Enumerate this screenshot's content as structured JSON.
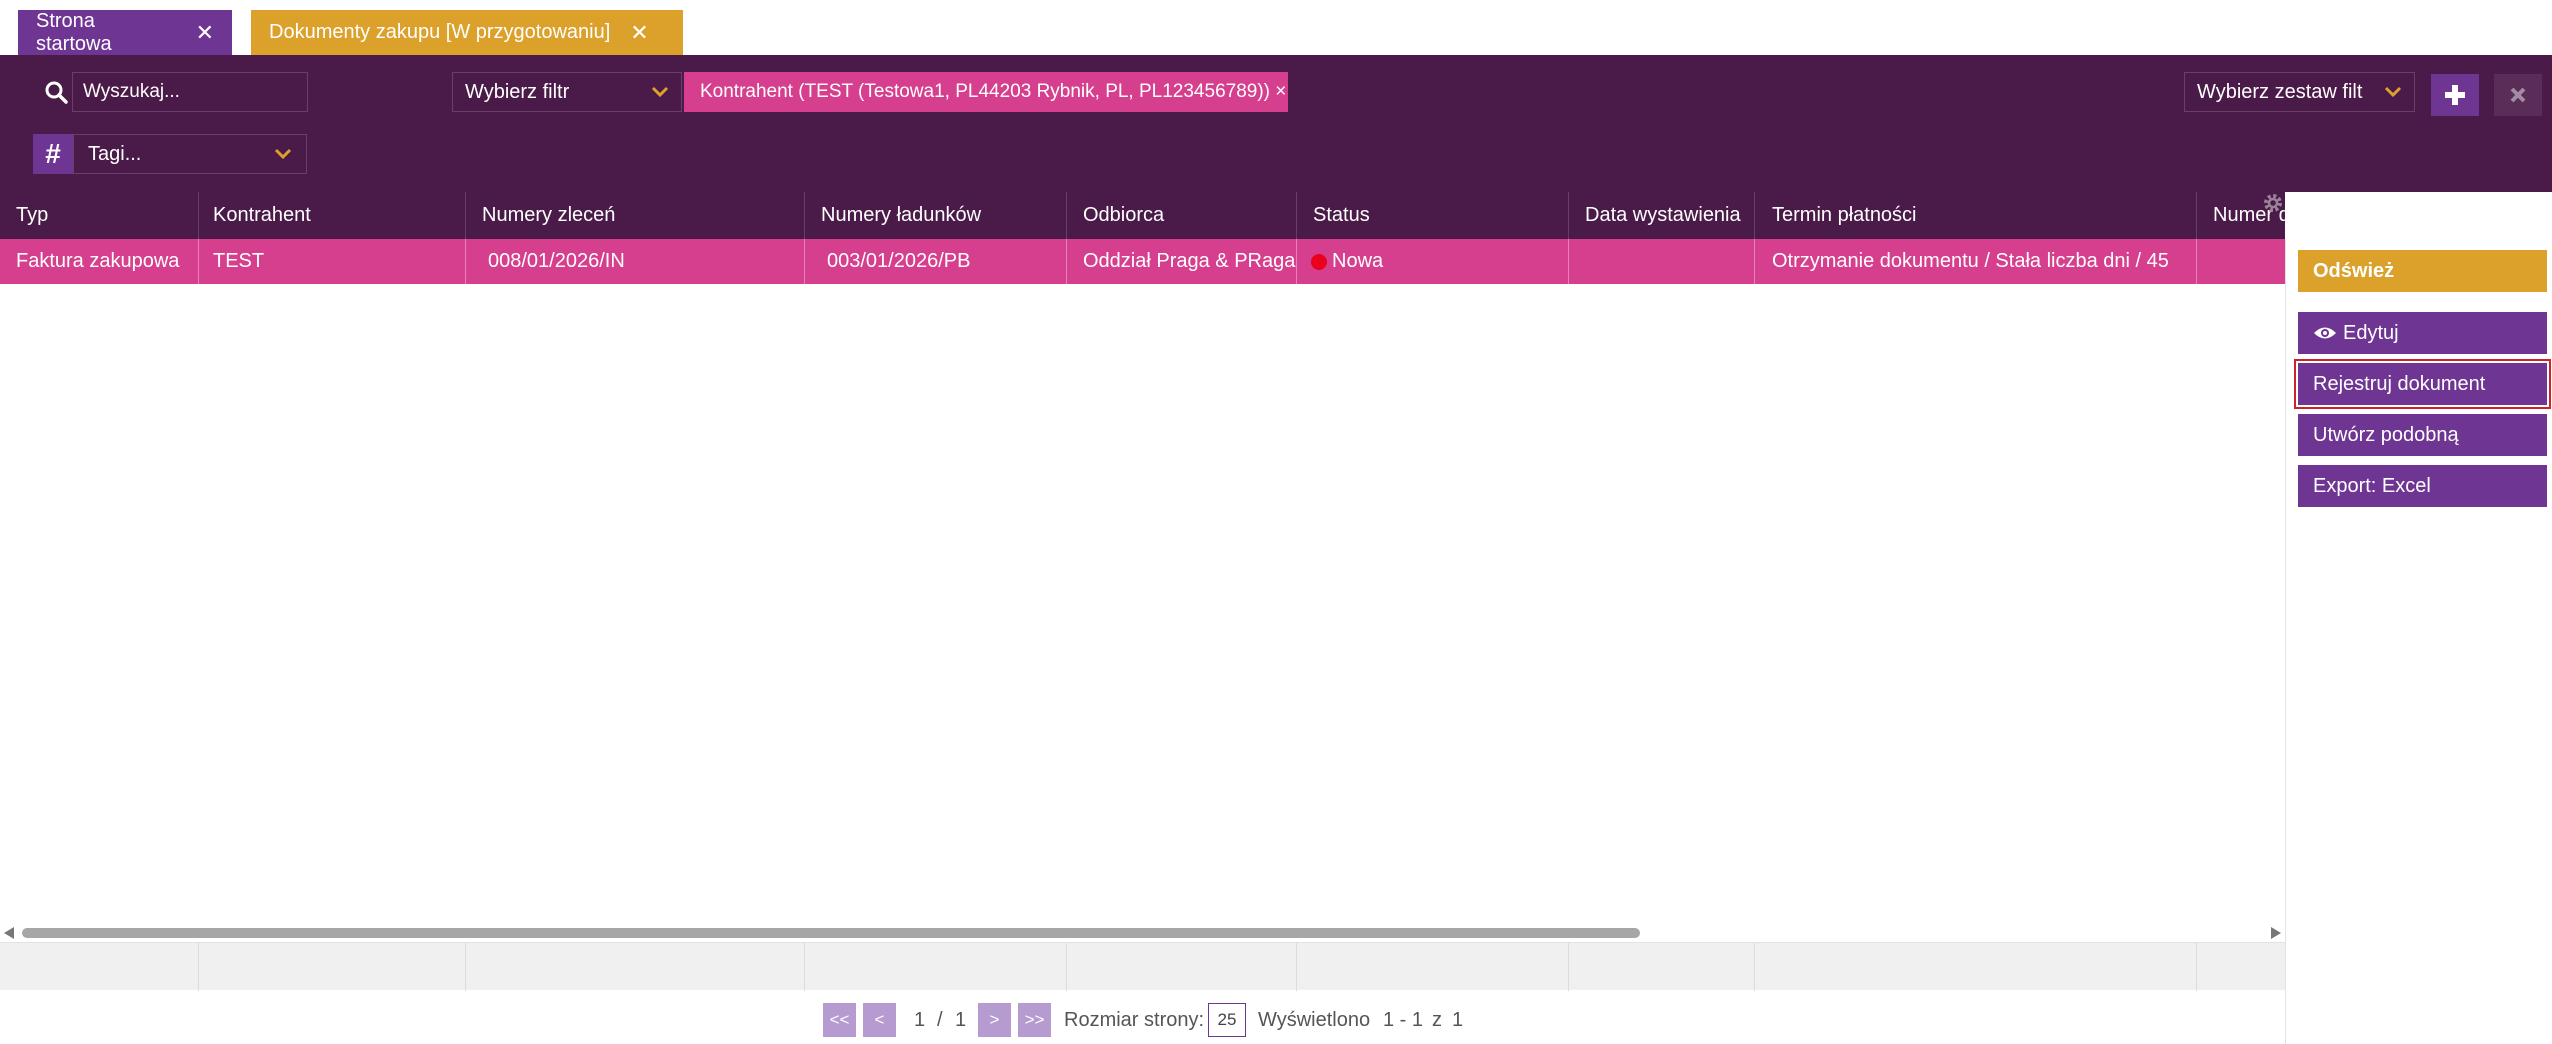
{
  "tabs": [
    {
      "label": "Strona startowa",
      "close": "✕"
    },
    {
      "label": "Dokumenty zakupu [W przygotowaniu]",
      "close": "✕"
    }
  ],
  "toolbar": {
    "search_placeholder": "Wyszukaj...",
    "filter_select": "Wybierz filtr",
    "active_filter": "Kontrahent (TEST (Testowa1, PL44203 Rybnik, PL, PL123456789)) ×",
    "filter_set_select": "Wybierz zestaw filt",
    "tag_symbol": "#",
    "tags_select": "Tagi..."
  },
  "table": {
    "columns": [
      "Typ",
      "Kontrahent",
      "Numery zleceń",
      "Numery ładunków",
      "Odbiorca",
      "Status",
      "Data wystawienia",
      "Termin płatności",
      "Numer d..."
    ],
    "rows": [
      {
        "typ": "Faktura zakupowa",
        "kontrahent": "TEST",
        "numery_zlecen": "008/01/2026/IN",
        "numery_ladunkow": "003/01/2026/PB",
        "odbiorca": "Oddział Praga & PRaga",
        "status": "Nowa",
        "data_wystawienia": "",
        "termin_platnosci": "Otrzymanie dokumentu / Stała liczba dni / 45",
        "numer": ""
      }
    ]
  },
  "pager": {
    "first": "<<",
    "prev": "<",
    "current": "1",
    "separator": "/",
    "total": "1",
    "next": ">",
    "last": ">>",
    "page_size_label": "Rozmiar strony:",
    "page_size": "25",
    "shown_label": "Wyświetlono",
    "shown_range": "1 - 1",
    "of_label": "z",
    "shown_total": "1"
  },
  "actions": {
    "refresh": "Odśwież",
    "edit": "Edytuj",
    "register": "Rejestruj dokument",
    "create_similar": "Utwórz podobną",
    "export": "Export: Excel"
  },
  "colors": {
    "purple_dark": "#4a1b48",
    "purple": "#6f3592",
    "pink": "#d63f8e",
    "gold": "#dba12a",
    "status_new": "#e8001c"
  }
}
